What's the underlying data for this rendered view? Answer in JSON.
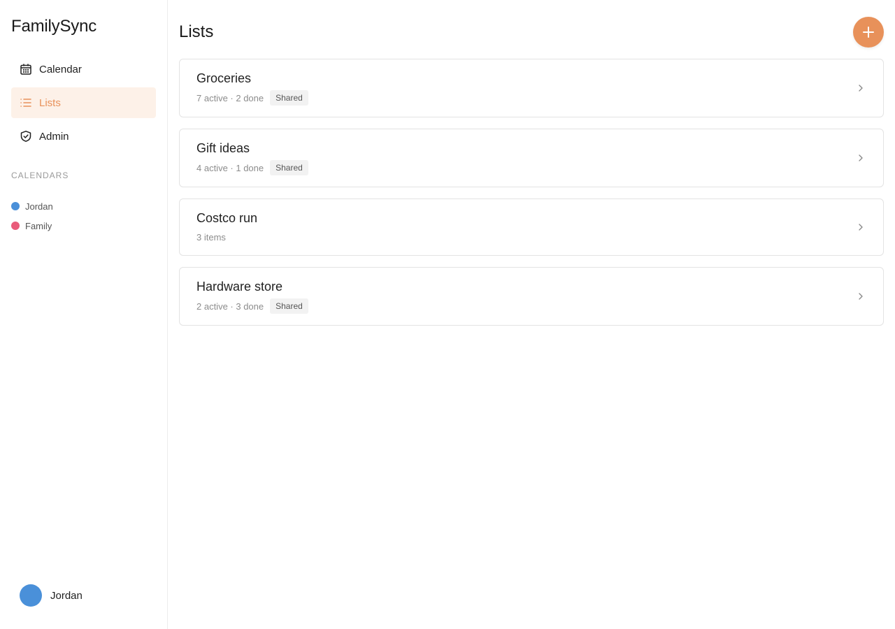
{
  "app": {
    "name": "FamilySync"
  },
  "nav": [
    {
      "label": "Calendar",
      "icon": "calendar-icon",
      "active": false
    },
    {
      "label": "Lists",
      "icon": "list-icon",
      "active": true
    },
    {
      "label": "Admin",
      "icon": "shield-icon",
      "active": false
    }
  ],
  "calendars": {
    "section_label": "CALENDARS",
    "items": [
      {
        "name": "Jordan",
        "color": "#4a90d9"
      },
      {
        "name": "Family",
        "color": "#e95b7a"
      }
    ]
  },
  "user": {
    "name": "Jordan",
    "avatar_color": "#4a90d9"
  },
  "page": {
    "title": "Lists",
    "add_icon": "plus-icon"
  },
  "lists": [
    {
      "title": "Groceries",
      "meta": "7 active · 2 done",
      "badge": "Shared"
    },
    {
      "title": "Gift ideas",
      "meta": "4 active · 1 done",
      "badge": "Shared"
    },
    {
      "title": "Costco run",
      "meta": "3 items",
      "badge": ""
    },
    {
      "title": "Hardware store",
      "meta": "2 active · 3 done",
      "badge": "Shared"
    }
  ],
  "colors": {
    "accent": "#e8915a",
    "accent_bg": "#fdf1e8"
  }
}
